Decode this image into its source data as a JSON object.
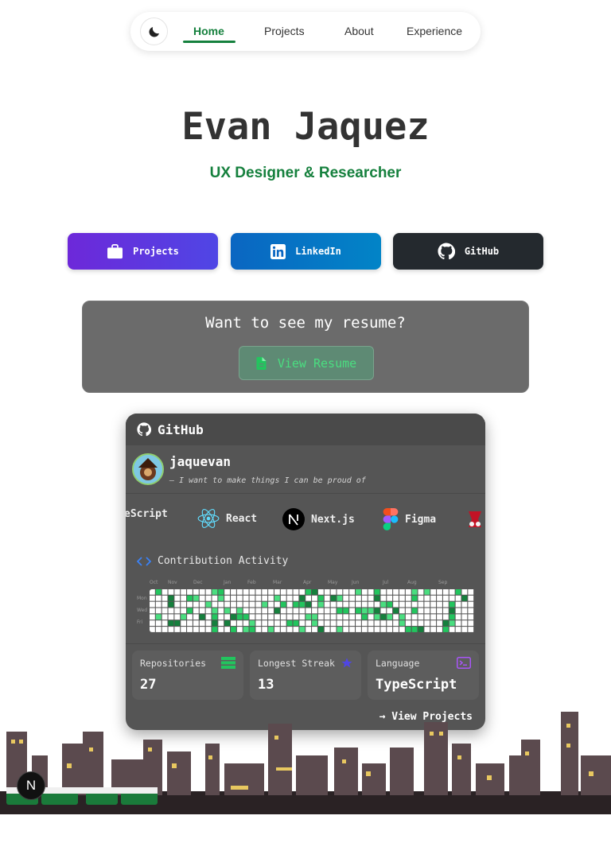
{
  "nav": {
    "items": [
      {
        "label": "Home"
      },
      {
        "label": "Projects"
      },
      {
        "label": "About"
      },
      {
        "label": "Experience"
      }
    ],
    "active": "Home"
  },
  "hero": {
    "name": "Evan Jaquez",
    "role": "UX Designer & Researcher"
  },
  "buttons": {
    "projects": "Projects",
    "linkedin": "LinkedIn",
    "github": "GitHub"
  },
  "resume": {
    "title": "Want to see my resume?",
    "button": "View Resume"
  },
  "github_card": {
    "title": "GitHub",
    "username": "jaquevan",
    "bio": "— I want to make things I can be proud of",
    "tech": [
      {
        "label": "eScript",
        "icon": "typescript-icon"
      },
      {
        "label": "React",
        "icon": "react-icon"
      },
      {
        "label": "Next.js",
        "icon": "nextjs-icon"
      },
      {
        "label": "Figma",
        "icon": "figma-icon"
      },
      {
        "label": "",
        "icon": "jest-icon"
      }
    ],
    "contribution": {
      "title": "Contribution Activity",
      "months": [
        "Oct",
        "Nov",
        "Dec",
        "Jan",
        "Feb",
        "Mar",
        "Apr",
        "May",
        "Jun",
        "Jul",
        "Aug",
        "Sep"
      ],
      "days": [
        "Mon",
        "Wed",
        "Fri"
      ]
    },
    "stats": [
      {
        "label": "Repositories",
        "value": "27",
        "icon": "database-icon"
      },
      {
        "label": "Longest Streak",
        "value": "13",
        "icon": "star-icon"
      },
      {
        "label": "Language",
        "value": "TypeScript",
        "icon": "terminal-icon"
      }
    ],
    "view_projects": "→ View Projects"
  },
  "colors": {
    "accent": "#15803d",
    "card_bg": "#555555",
    "contrib_high": "#15803d",
    "contrib_mid": "#22c55e",
    "contrib_low": "#4ade80"
  }
}
